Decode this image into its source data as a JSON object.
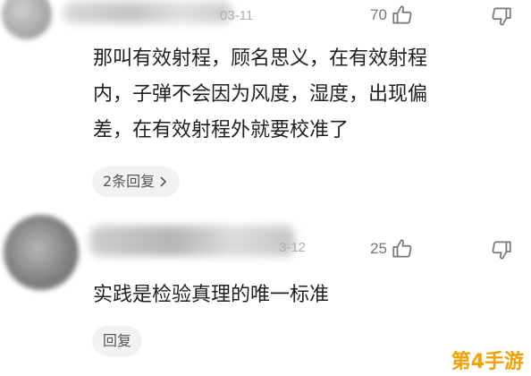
{
  "comments": [
    {
      "date_fragment": "03-11",
      "like_count": "70",
      "text_lines": [
        "那叫有效射程，顾名思义，在有效射程",
        "内，子弹不会因为风度，湿度，出现偏",
        "差，在有效射程外就要校准了"
      ],
      "reply_label": "2条回复",
      "icons": {
        "like": "thumbs-up-icon",
        "dislike": "thumbs-down-icon",
        "more": "chevron-right-icon"
      }
    },
    {
      "date_fragment": "3-12",
      "like_count": "25",
      "text_lines": [
        "实践是检验真理的唯一标准"
      ],
      "reply_label": "回复",
      "icons": {
        "like": "thumbs-up-icon",
        "dislike": "thumbs-down-icon"
      }
    }
  ],
  "watermark": {
    "text": "第4手游",
    "color": "#f2a100"
  },
  "colors": {
    "meta_text": "#b0b0b0",
    "icon": "#777777",
    "reply_bg": "#f2f2f2"
  }
}
